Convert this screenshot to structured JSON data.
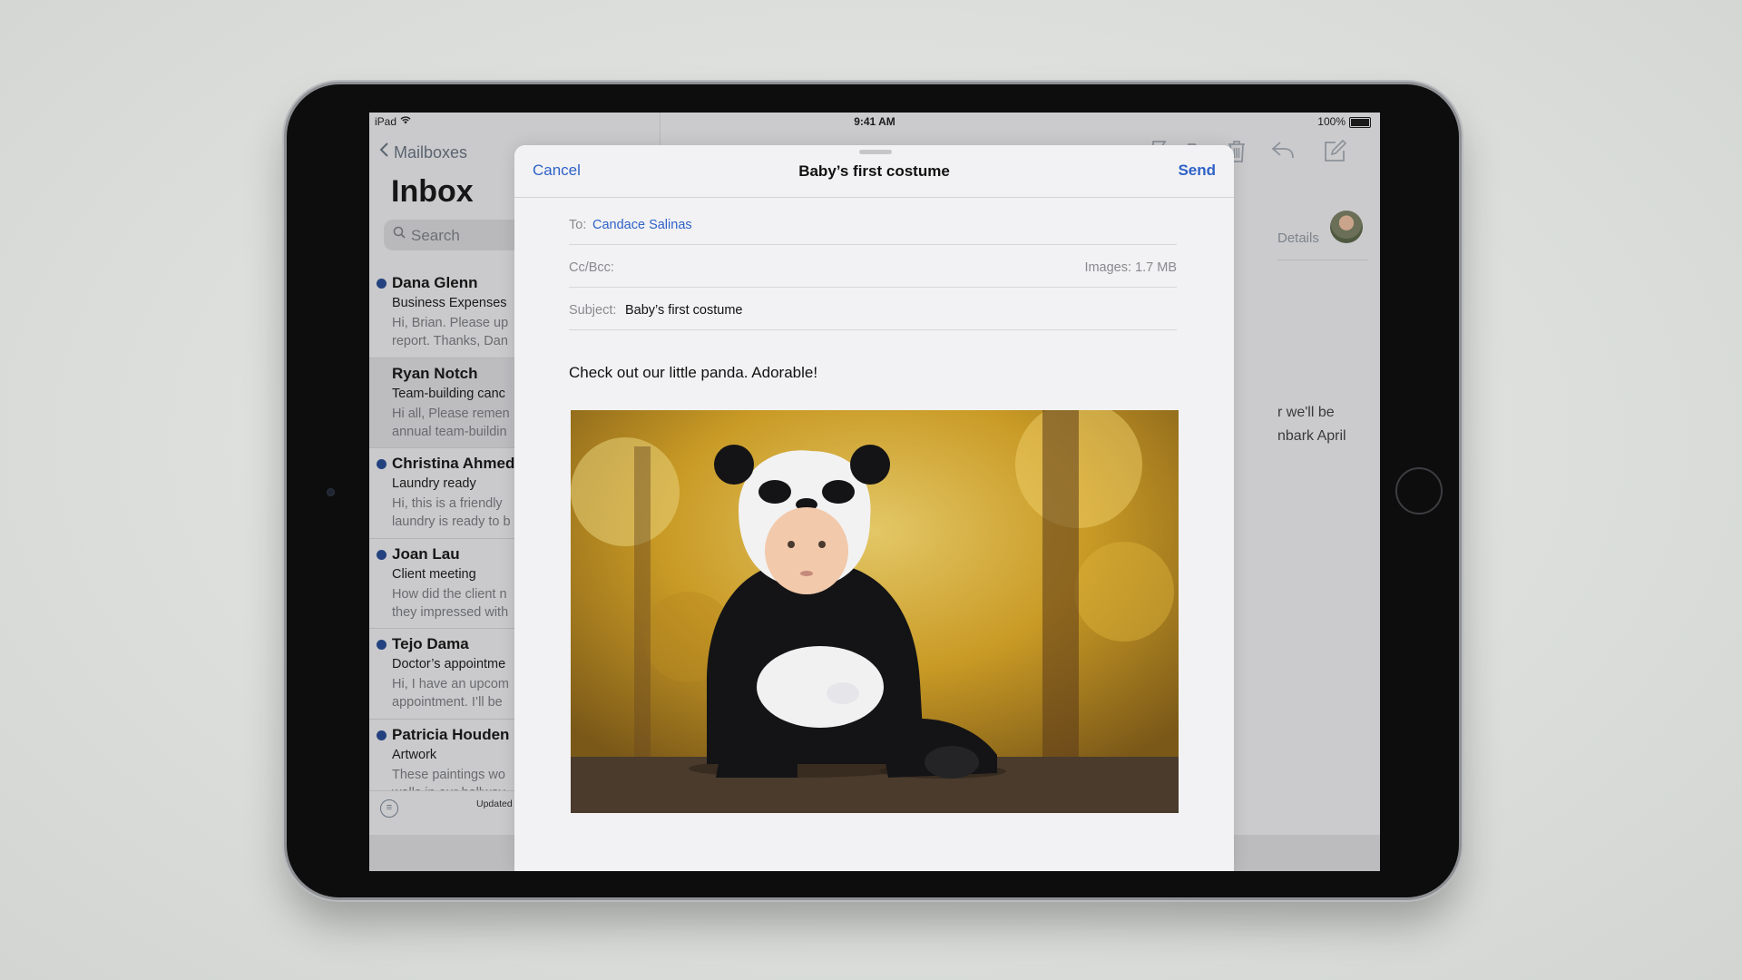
{
  "status_bar": {
    "device_name": "iPad",
    "time": "9:41 AM",
    "battery": "100%"
  },
  "mailbox_list": {
    "back_label": "Mailboxes",
    "title": "Inbox",
    "search_placeholder": "Search",
    "messages": [
      {
        "sender": "Dana Glenn",
        "subject": "Business Expenses",
        "preview_line1": "Hi, Brian. Please up",
        "preview_line2": "report. Thanks, Dan",
        "unread": true
      },
      {
        "sender": "Ryan Notch",
        "subject": "Team-building canc",
        "preview_line1": "Hi all, Please remen",
        "preview_line2": "annual team-buildin",
        "unread": false
      },
      {
        "sender": "Christina Ahmed",
        "subject": "Laundry ready",
        "preview_line1": "Hi, this is a friendly",
        "preview_line2": "laundry is ready to b",
        "unread": true
      },
      {
        "sender": "Joan Lau",
        "subject": "Client meeting",
        "preview_line1": "How did the client n",
        "preview_line2": "they impressed with",
        "unread": true
      },
      {
        "sender": "Tejo Dama",
        "subject": "Doctor’s appointme",
        "preview_line1": "Hi, I have an upcom",
        "preview_line2": "appointment. I’ll be",
        "unread": true
      },
      {
        "sender": "Patricia Houden",
        "subject": "Artwork",
        "preview_line1": "These paintings wo",
        "preview_line2": "walls in our hallway.",
        "unread": true
      }
    ],
    "footer_status": "Updated"
  },
  "message_view": {
    "details_label": "Details",
    "body_peek_line1": "r we'll be",
    "body_peek_line2": "nbark April"
  },
  "compose": {
    "cancel_label": "Cancel",
    "title": "Baby’s first costume",
    "send_label": "Send",
    "to_label": "To:",
    "to_value": "Candace Salinas",
    "ccbcc_label": "Cc/Bcc:",
    "images_label": "Images:",
    "images_size": "1.7 MB",
    "subject_label": "Subject:",
    "subject_value": "Baby’s first costume",
    "body": "Check out our little panda. Adorable!"
  },
  "colors": {
    "accent": "#2f62c7",
    "unread_dot": "#24427f"
  },
  "icons": [
    "wifi-icon",
    "battery-icon",
    "chevron-left-icon",
    "search-icon",
    "filter-icon",
    "trash-icon",
    "reply-icon",
    "compose-icon",
    "flag-icon",
    "folder-icon"
  ]
}
